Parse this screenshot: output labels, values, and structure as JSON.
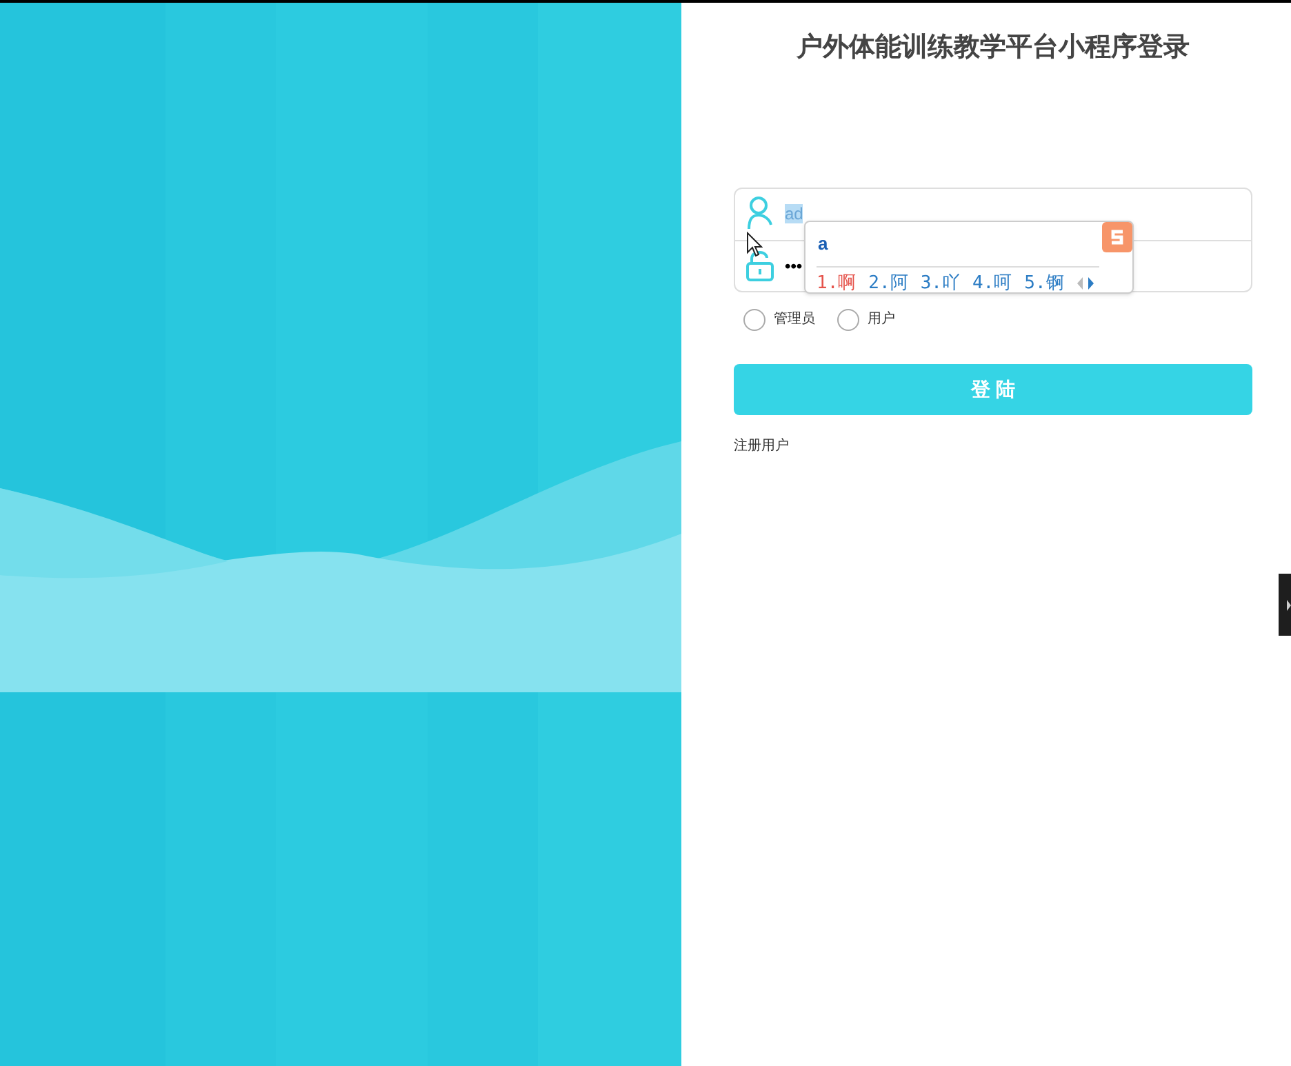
{
  "title": "户外体能训练教学平台小程序登录",
  "fields": [
    {
      "kind": "username",
      "value": "ad"
    },
    {
      "kind": "password",
      "value": "•••"
    }
  ],
  "roles": [
    {
      "label": "管理员",
      "selected": false
    },
    {
      "label": "用户",
      "selected": false
    }
  ],
  "login_button": "登 陆",
  "register_link": "注册用户",
  "ime_popup": {
    "composition": "a",
    "candidates": [
      {
        "label": "1.啊",
        "selected": true
      },
      {
        "label": "2.阿",
        "selected": false
      },
      {
        "label": "3.吖",
        "selected": false
      },
      {
        "label": "4.呵",
        "selected": false
      },
      {
        "label": "5.锕",
        "selected": false
      }
    ]
  }
}
